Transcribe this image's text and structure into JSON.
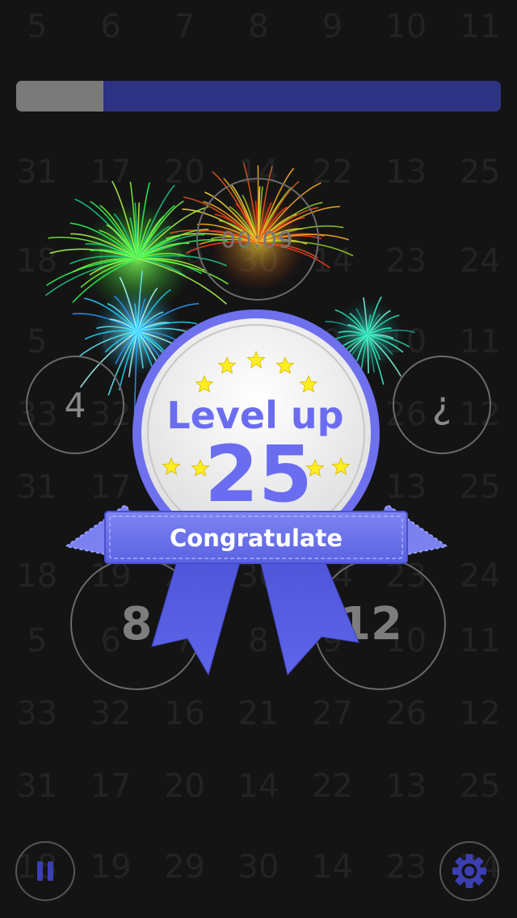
{
  "background_numbers": [
    [
      "5",
      "6",
      "7",
      "8",
      "9",
      "10",
      "11"
    ],
    [
      "31",
      "17",
      "20",
      "14",
      "22",
      "13",
      "25"
    ],
    [
      "18",
      "19",
      "29",
      "30",
      "14",
      "23",
      "24"
    ],
    [
      "5",
      "6",
      "7",
      "8",
      "9",
      "10",
      "11"
    ],
    [
      "33",
      "32",
      "16",
      "21",
      "27",
      "26",
      "12"
    ],
    [
      "31",
      "17",
      "20",
      "14",
      "22",
      "13",
      "25"
    ],
    [
      "18",
      "19",
      "29",
      "30",
      "14",
      "23",
      "24"
    ],
    [
      "5",
      "6",
      "7",
      "8",
      "9",
      "10",
      "11"
    ],
    [
      "33",
      "32",
      "16",
      "21",
      "27",
      "26",
      "12"
    ],
    [
      "31",
      "17",
      "20",
      "14",
      "22",
      "13",
      "25"
    ],
    [
      "18",
      "19",
      "29",
      "30",
      "14",
      "23",
      "24"
    ]
  ],
  "progress": {
    "value": 0.18
  },
  "timer": "00:09",
  "circles": {
    "left_small": "4",
    "right_small": "¿",
    "bottom_left": "8",
    "bottom_right": "12"
  },
  "badge": {
    "title": "Level up",
    "level": "25",
    "ribbon_text": "Congratulate"
  },
  "controls": {
    "pause_icon": "pause-icon",
    "settings_icon": "gear-icon"
  },
  "colors": {
    "accent": "#6b6df0",
    "progress_track": "#2e3282",
    "progress_fill": "#7a7a7a",
    "badge_face": "#f2f2f2",
    "star": "#ffee22"
  }
}
